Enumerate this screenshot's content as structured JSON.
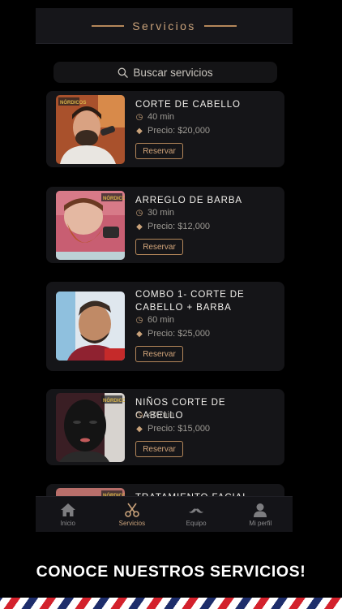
{
  "header": {
    "title": "Servicios"
  },
  "search": {
    "placeholder": "Buscar servicios"
  },
  "services": [
    {
      "name": "CORTE DE CABELLO",
      "duration": "40 min",
      "price": "Precio: $20,000",
      "button": "Reservar",
      "badge": "NÓRDICOS"
    },
    {
      "name": "ARREGLO DE BARBA",
      "duration": "30 min",
      "price": "Precio: $12,000",
      "button": "Reservar",
      "badge": "NÓRDICOS"
    },
    {
      "name": "COMBO 1- CORTE DE CABELLO + BARBA",
      "duration": "60 min",
      "price": "Precio: $25,000",
      "button": "Reservar"
    },
    {
      "name": "NIÑOS CORTE DE CABELLO",
      "duration": "40 min",
      "price": "Precio: $15,000",
      "button": "Reservar",
      "badge": "NÓRDICOS"
    },
    {
      "name": "TRATAMIENTO FACIAL BLACK",
      "badge": "NÓRDICOS"
    }
  ],
  "tabs": [
    {
      "label": "Inicio",
      "icon": "home-icon"
    },
    {
      "label": "Servicios",
      "icon": "scissors-icon",
      "active": true
    },
    {
      "label": "Equipo",
      "icon": "mustache-icon"
    },
    {
      "label": "Mi perfil",
      "icon": "user-icon"
    }
  ],
  "promo": {
    "text": "CONOCE NUESTROS SERVICIOS!"
  },
  "colors": {
    "accent": "#c9a27a",
    "background": "#000000",
    "card": "#151518"
  }
}
